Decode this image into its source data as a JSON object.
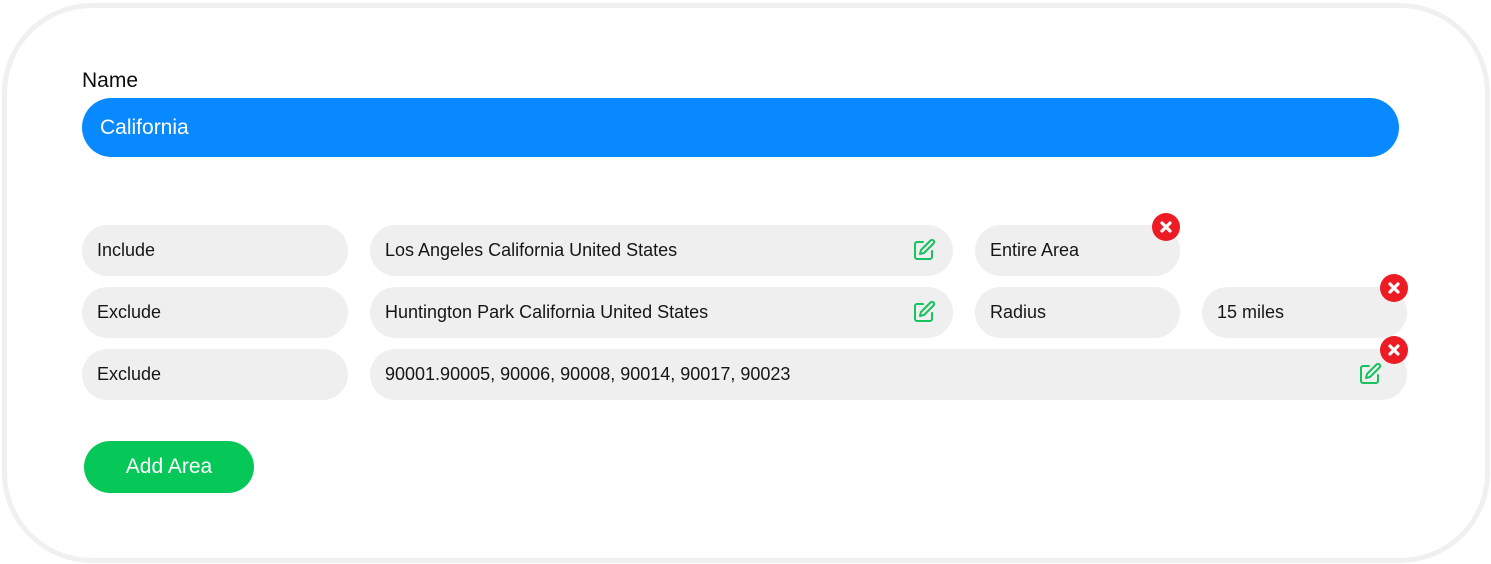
{
  "form": {
    "name_label": "Name",
    "name_value": "California"
  },
  "rows": [
    {
      "mode": "Include",
      "location": "Los Angeles California United States",
      "scope": "Entire Area"
    },
    {
      "mode": "Exclude",
      "location": "Huntington Park California United States",
      "scope": "Radius",
      "radius": "15 miles"
    },
    {
      "mode": "Exclude",
      "location": "90001.90005, 90006, 90008, 90014, 90017, 90023"
    }
  ],
  "actions": {
    "add_area_label": "Add Area"
  },
  "icons": {
    "edit": "edit-icon",
    "remove": "remove-icon"
  },
  "colors": {
    "primary_blue": "#0989ff",
    "add_green": "#05c858",
    "edit_green": "#16c35e",
    "remove_red": "#ed1c24",
    "pill_gray": "#efefef"
  }
}
